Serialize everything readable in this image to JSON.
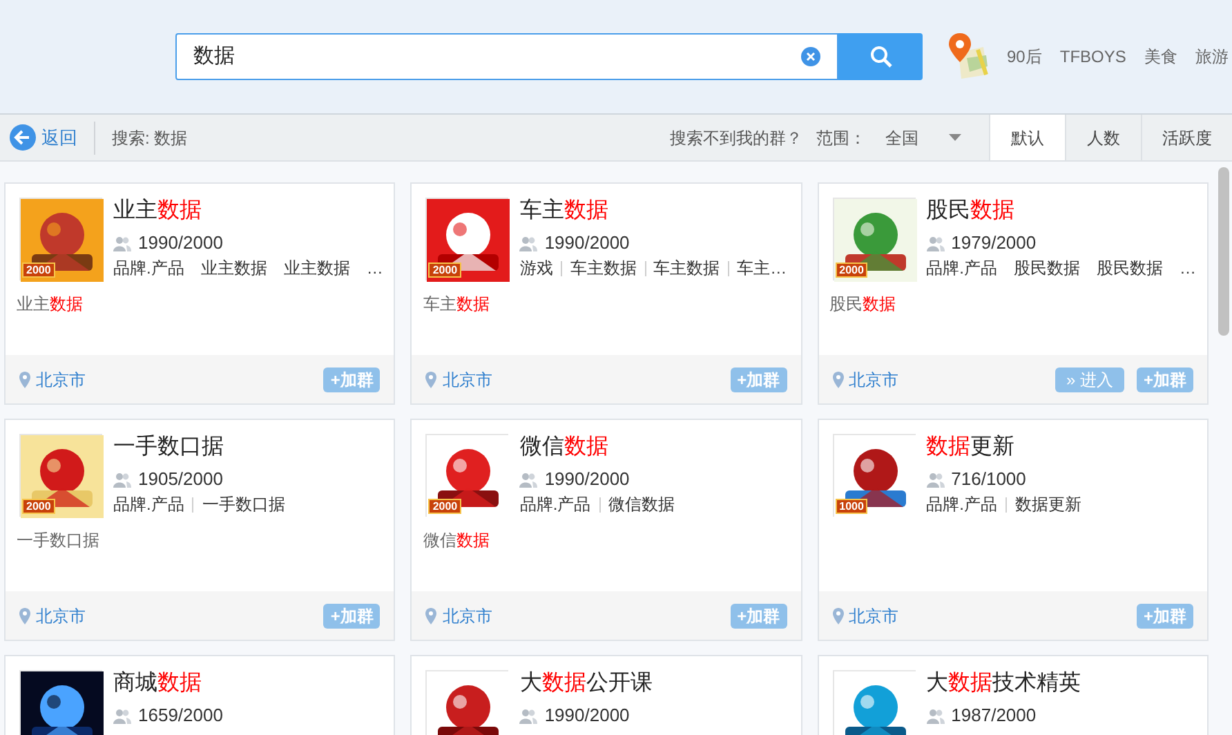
{
  "search": {
    "value": "数据"
  },
  "hot_words": [
    "90后",
    "TFBOYS",
    "美食",
    "旅游"
  ],
  "toolbar": {
    "back": "返回",
    "query": "搜索: 数据",
    "help_link": "搜索不到我的群？",
    "scope_label": "范围：",
    "scope_value": "全国",
    "sort_tabs": [
      {
        "label": "默认",
        "selected": true
      },
      {
        "label": "人数",
        "selected": false
      },
      {
        "label": "活跃度",
        "selected": false
      }
    ]
  },
  "cards": [
    {
      "title": [
        {
          "text": "业主",
          "highlight": false
        },
        {
          "text": "数据",
          "highlight": true
        }
      ],
      "badge": "2000",
      "members": "1990/2000",
      "tags": [
        "品牌.产品",
        "业主数据",
        "业主数据",
        "…"
      ],
      "description": [
        {
          "text": "业主",
          "highlight": false
        },
        {
          "text": "数据",
          "highlight": true
        }
      ],
      "location": "北京市",
      "buttons": [
        {
          "kind": "join",
          "label": "+加群"
        }
      ]
    },
    {
      "title": [
        {
          "text": "车主",
          "highlight": false
        },
        {
          "text": "数据",
          "highlight": true
        }
      ],
      "badge": "2000",
      "members": "1990/2000",
      "tags": [
        "游戏",
        "车主数据",
        "车主数据",
        "车主…"
      ],
      "description": [
        {
          "text": "车主",
          "highlight": false
        },
        {
          "text": "数据",
          "highlight": true
        }
      ],
      "location": "北京市",
      "buttons": [
        {
          "kind": "join",
          "label": "+加群"
        }
      ]
    },
    {
      "title": [
        {
          "text": "股民",
          "highlight": false
        },
        {
          "text": "数据",
          "highlight": true
        }
      ],
      "badge": "2000",
      "members": "1979/2000",
      "tags": [
        "品牌.产品",
        "股民数据",
        "股民数据",
        "…"
      ],
      "description": [
        {
          "text": "股民",
          "highlight": false
        },
        {
          "text": "数据",
          "highlight": true
        }
      ],
      "location": "北京市",
      "buttons": [
        {
          "kind": "enter",
          "label": "» 进入"
        },
        {
          "kind": "join",
          "label": "+加群"
        }
      ]
    },
    {
      "title": [
        {
          "text": "一手数口据",
          "highlight": false
        }
      ],
      "badge": "2000",
      "members": "1905/2000",
      "tags": [
        "品牌.产品",
        "一手数口据"
      ],
      "description": [
        {
          "text": "一手数口据",
          "highlight": false
        }
      ],
      "location": "北京市",
      "buttons": [
        {
          "kind": "join",
          "label": "+加群"
        }
      ]
    },
    {
      "title": [
        {
          "text": "微信",
          "highlight": false
        },
        {
          "text": "数据",
          "highlight": true
        }
      ],
      "badge": "2000",
      "members": "1990/2000",
      "tags": [
        "品牌.产品",
        "微信数据"
      ],
      "description": [
        {
          "text": "微信",
          "highlight": false
        },
        {
          "text": "数据",
          "highlight": true
        }
      ],
      "location": "北京市",
      "buttons": [
        {
          "kind": "join",
          "label": "+加群"
        }
      ]
    },
    {
      "title": [
        {
          "text": "数据",
          "highlight": true
        },
        {
          "text": "更新",
          "highlight": false
        }
      ],
      "badge": "1000",
      "members": "716/1000",
      "tags": [
        "品牌.产品",
        "数据更新"
      ],
      "location": "北京市",
      "buttons": [
        {
          "kind": "join",
          "label": "+加群"
        }
      ]
    },
    {
      "title": [
        {
          "text": "商城",
          "highlight": false
        },
        {
          "text": "数据",
          "highlight": true
        }
      ],
      "members": "1659/2000"
    },
    {
      "title": [
        {
          "text": "大",
          "highlight": false
        },
        {
          "text": "数据",
          "highlight": true
        },
        {
          "text": "公开课",
          "highlight": false
        }
      ],
      "members": "1990/2000"
    },
    {
      "title": [
        {
          "text": "大",
          "highlight": false
        },
        {
          "text": "数据",
          "highlight": true
        },
        {
          "text": "技术精英",
          "highlight": false
        }
      ],
      "members": "1987/2000"
    }
  ]
}
